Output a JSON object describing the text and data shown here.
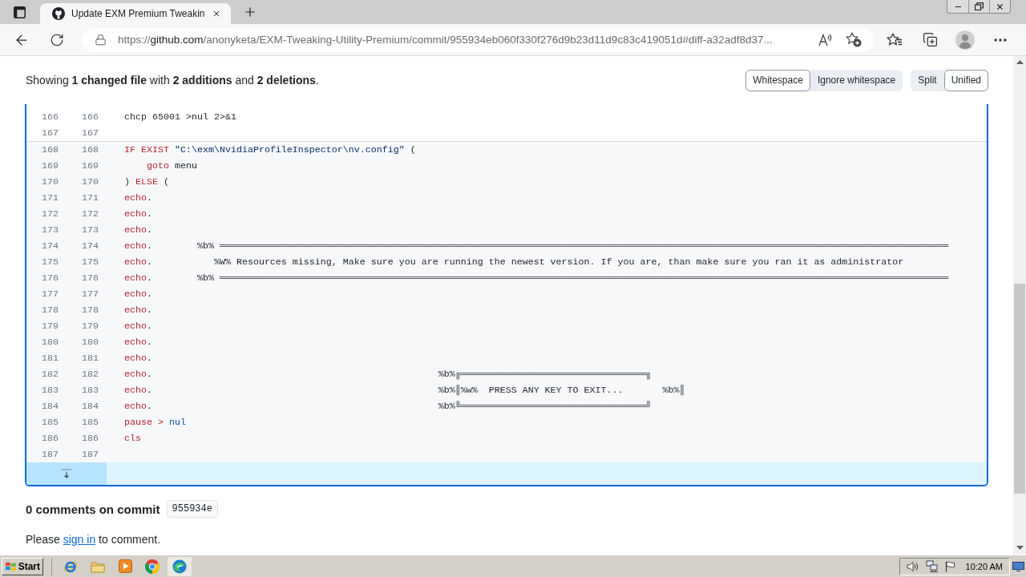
{
  "browser": {
    "tabs": [
      {
        "title": "Update EXM Premium Tweakin",
        "selected": true
      }
    ],
    "url": {
      "scheme": "https://",
      "host": "github.com",
      "path": "/anonyketa/EXM-Tweaking-Utility-Premium/commit/955934eb060f330f276d9b23d11d9c83c419051d#diff-a32adf8d37..."
    }
  },
  "diff_toolbar": {
    "summary": "Showing **1 changed file** with **2 additions** and **2 deletions**.",
    "whitespace_options": [
      {
        "label": "Whitespace",
        "selected": true
      },
      {
        "label": "Ignore whitespace",
        "selected": false
      }
    ],
    "view_options": [
      {
        "label": "Split",
        "selected": false
      },
      {
        "label": "Unified",
        "selected": true
      }
    ]
  },
  "diff": {
    "hunks": [
      {
        "expanded": false,
        "lines": [
          {
            "old": "166",
            "new": "166",
            "tokens": [
              {
                "text": "chcp 65001 >nul 2>&1",
                "kind": "plain"
              }
            ]
          },
          {
            "old": "167",
            "new": "167"
          }
        ]
      },
      {
        "expanded": true,
        "lines": [
          {
            "old": "168",
            "new": "168",
            "tokens": [
              {
                "text": "IF EXIST",
                "kind": "keyword"
              },
              {
                "text": " \"C:\\exm\\NvidiaProfileInspector\\nv.config\"",
                "kind": "string"
              },
              {
                "text": " (",
                "kind": "plain"
              }
            ]
          },
          {
            "old": "169",
            "new": "169",
            "tokens": [
              {
                "text": "    goto",
                "kind": "keyword"
              },
              {
                "text": " menu",
                "kind": "plain"
              }
            ]
          },
          {
            "old": "170",
            "new": "170",
            "tokens": [
              {
                "text": ")",
                "kind": "plain"
              },
              {
                "text": " ELSE",
                "kind": "keyword"
              },
              {
                "text": " (",
                "kind": "plain"
              }
            ]
          },
          {
            "old": "171",
            "new": "171",
            "tokens": [
              {
                "text": "echo",
                "kind": "keyword"
              },
              {
                "text": ".",
                "kind": "plain"
              }
            ]
          },
          {
            "old": "172",
            "new": "172",
            "tokens": [
              {
                "text": "echo",
                "kind": "keyword"
              },
              {
                "text": ".",
                "kind": "plain"
              }
            ]
          },
          {
            "old": "173",
            "new": "173",
            "tokens": [
              {
                "text": "echo",
                "kind": "keyword"
              },
              {
                "text": ".",
                "kind": "plain"
              }
            ]
          },
          {
            "old": "174",
            "new": "174",
            "tokens": [
              {
                "text": "echo",
                "kind": "keyword"
              },
              {
                "text": ".        %b% ══════════════════════════════════════════════════════════════════════════════════════════════════════════════════════════════════",
                "kind": "plain"
              }
            ]
          },
          {
            "old": "175",
            "new": "175",
            "tokens": [
              {
                "text": "echo",
                "kind": "keyword"
              },
              {
                "text": ".           %W% Resources missing, Make sure you are running the newest version. If you are, than make sure you ran it as administrator",
                "kind": "plain"
              }
            ]
          },
          {
            "old": "176",
            "new": "176",
            "tokens": [
              {
                "text": "echo",
                "kind": "keyword"
              },
              {
                "text": ".        %b% ══════════════════════════════════════════════════════════════════════════════════════════════════════════════════════════════════",
                "kind": "plain"
              }
            ]
          },
          {
            "old": "177",
            "new": "177",
            "tokens": [
              {
                "text": "echo",
                "kind": "keyword"
              },
              {
                "text": ".",
                "kind": "plain"
              }
            ]
          },
          {
            "old": "178",
            "new": "178",
            "tokens": [
              {
                "text": "echo",
                "kind": "keyword"
              },
              {
                "text": ".",
                "kind": "plain"
              }
            ]
          },
          {
            "old": "179",
            "new": "179",
            "tokens": [
              {
                "text": "echo",
                "kind": "keyword"
              },
              {
                "text": ".",
                "kind": "plain"
              }
            ]
          },
          {
            "old": "180",
            "new": "180",
            "tokens": [
              {
                "text": "echo",
                "kind": "keyword"
              },
              {
                "text": ".",
                "kind": "plain"
              }
            ]
          },
          {
            "old": "181",
            "new": "181",
            "tokens": [
              {
                "text": "echo",
                "kind": "keyword"
              },
              {
                "text": ".",
                "kind": "plain"
              }
            ]
          },
          {
            "old": "182",
            "new": "182",
            "tokens": [
              {
                "text": "echo",
                "kind": "keyword"
              },
              {
                "text": ".                                                   %b%╔═════════════════════════════════╗",
                "kind": "plain"
              }
            ]
          },
          {
            "old": "183",
            "new": "183",
            "tokens": [
              {
                "text": "echo",
                "kind": "keyword"
              },
              {
                "text": ".                                                   %b%║%w%  PRESS ANY KEY TO EXIT...       %b%║",
                "kind": "plain"
              }
            ]
          },
          {
            "old": "184",
            "new": "184",
            "tokens": [
              {
                "text": "echo",
                "kind": "keyword"
              },
              {
                "text": ".                                                   %b%╚═════════════════════════════════╝",
                "kind": "plain"
              }
            ]
          },
          {
            "old": "185",
            "new": "185",
            "tokens": [
              {
                "text": "pause",
                "kind": "keyword"
              },
              {
                "text": " >",
                "kind": "keyword"
              },
              {
                "text": " nul",
                "kind": "constant"
              }
            ]
          },
          {
            "old": "186",
            "new": "186",
            "tokens": [
              {
                "text": "cls",
                "kind": "keyword"
              }
            ]
          },
          {
            "old": "187",
            "new": "187"
          }
        ]
      }
    ]
  },
  "comments": {
    "heading": "0 comments on commit",
    "commit": "955934e",
    "prompt": {
      "before": "Please",
      "link": "sign in",
      "after": "to comment."
    }
  },
  "taskbar": {
    "start": "Start",
    "apps": [
      {
        "kind": "ie",
        "selected": false
      },
      {
        "kind": "folder",
        "selected": false
      },
      {
        "kind": "media",
        "selected": false
      },
      {
        "kind": "chrome",
        "selected": false
      },
      {
        "kind": "edge",
        "selected": true
      }
    ],
    "clock": "10:20 AM"
  }
}
